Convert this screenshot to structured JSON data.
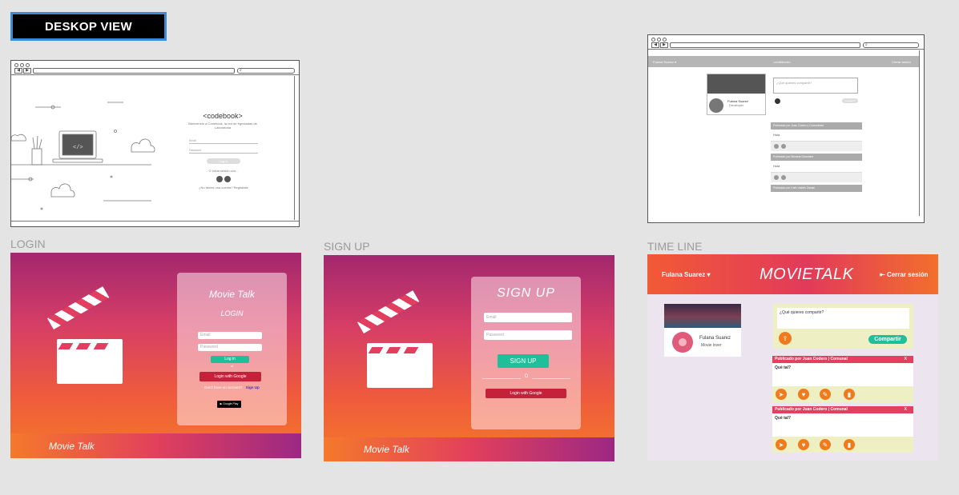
{
  "header": {
    "tag": "DESKOP VIEW"
  },
  "captions": {
    "login": "LOGIN",
    "signup": "SIGN UP",
    "timeline": "TIME LINE"
  },
  "wire_login": {
    "brand": "codebook",
    "welcome": "Bienvenido a Codebook, la red de egresadas de Laboratoria",
    "email": "Email",
    "password": "Password",
    "login_btn": "Log in",
    "or_login": "O inicia sesión con...",
    "no_account": "¿No tienes una cuenta? Registrate"
  },
  "wire_timeline": {
    "user": "Fulana Suarez",
    "brand": "codebook",
    "logout": "Cerrar sesión",
    "profile_name": "Fulana Suarez",
    "profile_sub": "Developer",
    "share_placeholder": "¿Qué quieres compartir?",
    "share_btn": "Compartir",
    "posts": [
      {
        "author": "Publicado por Juan Codero | Comunidad",
        "text": "Hola"
      },
      {
        "author": "Publicado por Micaela González",
        "text": "Hola"
      },
      {
        "author": "Publicado por Kath Valdés Zárate"
      }
    ]
  },
  "login": {
    "title": "Movie Talk",
    "subtitle": "LOGIN",
    "email_placeholder": "Email",
    "password_placeholder": "Password",
    "login_btn": "Log in",
    "or": "or",
    "google_btn": "Login with Google",
    "no_account": "Don't have an account?",
    "signup_link": "Sign Up",
    "store_badge": "Google Play",
    "footer": "Movie Talk"
  },
  "signup": {
    "title": "SIGN UP",
    "email_placeholder": "Email",
    "password_placeholder": "Password",
    "signup_btn": "SIGN UP",
    "or": "O",
    "google_btn": "Login with Google",
    "footer": "Movie Talk"
  },
  "timeline": {
    "user": "Fulana Suarez",
    "brand": "MOVIETALK",
    "logout": "Cerrar sesión",
    "profile_name": "Fulana Suarez",
    "profile_sub": "Movie lover",
    "share_placeholder": "¿Qué quieres compartir?",
    "share_btn": "Compartir",
    "posts": [
      {
        "author": "Publicado por Juan Codero | Comunal",
        "text": "Qué tal?",
        "close": "X"
      },
      {
        "author": "Publicado por Juan Codero | Comunal",
        "text": "Qué tal?",
        "close": "X"
      }
    ]
  },
  "colors": {
    "teal": "#1fbf9a",
    "red": "#c4213a",
    "orange": "#f07a1e",
    "pink": "#e2405e",
    "purple": "#9c2883"
  },
  "icons": [
    "clapperboard-icon",
    "search-icon",
    "logout-icon",
    "send-icon",
    "heart-icon",
    "edit-icon",
    "trash-icon",
    "upload-icon",
    "chevron-down-icon",
    "google-icon",
    "facebook-icon"
  ]
}
